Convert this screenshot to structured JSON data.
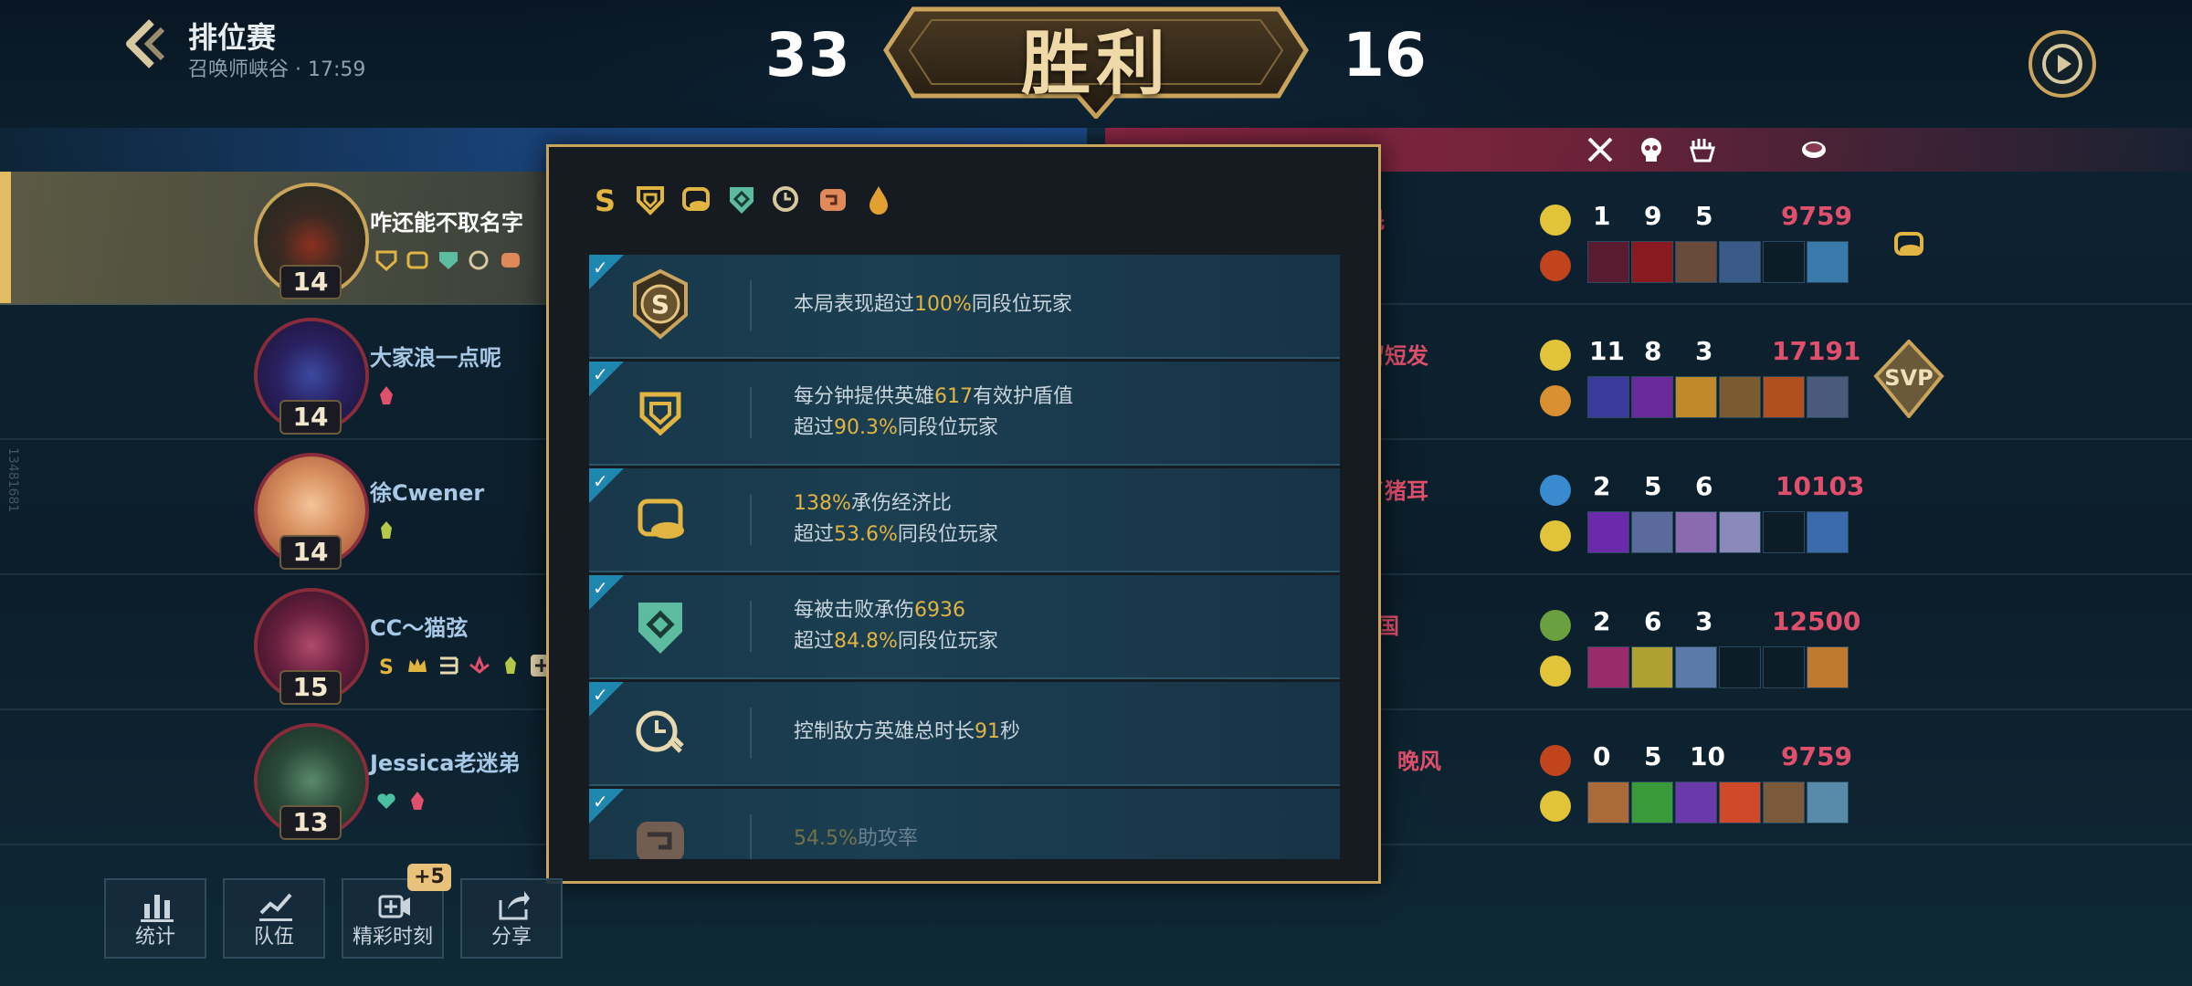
{
  "header": {
    "mode_title": "排位赛",
    "subtitle": "召唤师峡谷 · 17:59",
    "score_left": "33",
    "score_right": "16",
    "result": "胜利"
  },
  "blue_team": [
    {
      "name": "咋还能不取名字",
      "level": "14",
      "me": true
    },
    {
      "name": "大家浪一点呢",
      "level": "14"
    },
    {
      "name": "徐Cwener",
      "level": "14"
    },
    {
      "name": "CC～猫弦",
      "level": "15"
    },
    {
      "name": "Jessica老迷弟",
      "level": "13"
    }
  ],
  "red_team": [
    {
      "name_fragment": "花魁",
      "kills": "1",
      "deaths": "9",
      "assists": "5",
      "gold": "9759"
    },
    {
      "name_fragment": "她留短发",
      "kills": "11",
      "deaths": "8",
      "assists": "3",
      "gold": "17191"
    },
    {
      "name_fragment": "吃了猪耳",
      "kills": "2",
      "deaths": "5",
      "assists": "6",
      "gold": "10103"
    },
    {
      "name_fragment": "国",
      "kills": "2",
      "deaths": "6",
      "assists": "3",
      "gold": "12500"
    },
    {
      "name_fragment": "晚风",
      "kills": "0",
      "deaths": "5",
      "assists": "10",
      "gold": "9759"
    }
  ],
  "svp_label": "SVP",
  "side_text": "13481681",
  "popup": {
    "items": [
      {
        "pre": "本局表现超过",
        "hl": "100%",
        "post": "同段位玩家",
        "line2_pre": "",
        "line2_hl": "",
        "line2_post": ""
      },
      {
        "pre": "每分钟提供英雄",
        "hl": "617",
        "post": "有效护盾值",
        "line2_pre": "超过",
        "line2_hl": "90.3%",
        "line2_post": "同段位玩家"
      },
      {
        "pre": "",
        "hl": "138%",
        "post": "承伤经济比",
        "line2_pre": "超过",
        "line2_hl": "53.6%",
        "line2_post": "同段位玩家"
      },
      {
        "pre": "每被击败承伤",
        "hl": "6936",
        "post": "",
        "line2_pre": "超过",
        "line2_hl": "84.8%",
        "line2_post": "同段位玩家"
      },
      {
        "pre": "控制敌方英雄总时长",
        "hl": "91",
        "post": "秒",
        "line2_pre": "",
        "line2_hl": "",
        "line2_post": ""
      },
      {
        "pre": "",
        "hl": "54.5%",
        "post": "助攻率",
        "line2_pre": "",
        "line2_hl": "",
        "line2_post": ""
      }
    ]
  },
  "buttons": {
    "stats": "统计",
    "team": "队伍",
    "highlights": "精彩时刻",
    "share": "分享",
    "highlights_badge": "+5"
  },
  "colors": {
    "gold_accent": "#c9a45a",
    "highlight": "#e2b441",
    "red_team": "#e0506c",
    "blue_name": "#a8c9e6"
  }
}
